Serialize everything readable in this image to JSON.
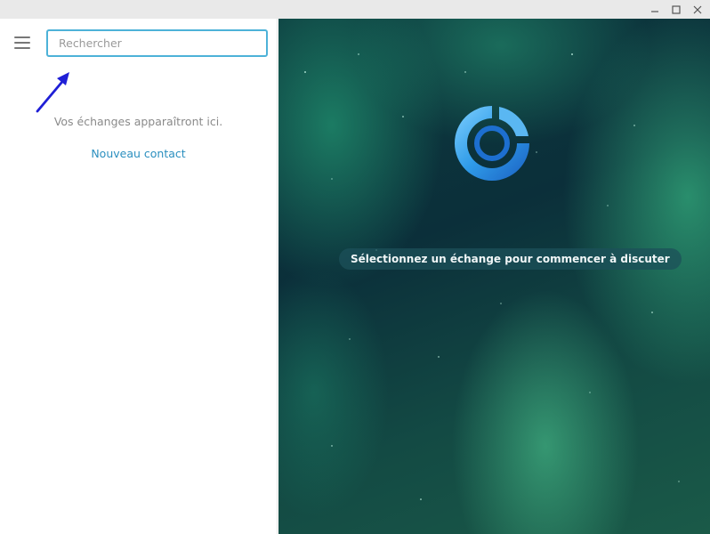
{
  "window": {
    "controls": [
      "minimize-icon",
      "maximize-icon",
      "close-icon"
    ]
  },
  "sidebar": {
    "menu_icon": "hamburger-icon",
    "search": {
      "placeholder": "Rechercher",
      "value": ""
    },
    "empty_message": "Vos échanges apparaîtront ici.",
    "new_contact_label": "Nouveau contact"
  },
  "main": {
    "hint": "Sélectionnez un échange pour commencer à discuter",
    "logo_icon": "app-logo-ring-icon"
  },
  "colors": {
    "accent": "#4db2d8",
    "link": "#2b8fbf",
    "annotation_arrow": "#1f1fd6"
  }
}
